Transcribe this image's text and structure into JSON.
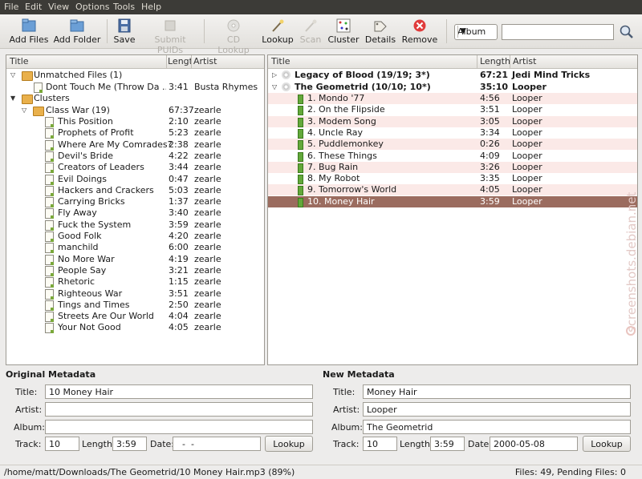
{
  "menu": [
    "File",
    "Edit",
    "View",
    "Options",
    "Tools",
    "Help"
  ],
  "toolbar": {
    "add_files": "Add Files",
    "add_folder": "Add Folder",
    "save": "Save",
    "submit_puids": "Submit PUIDs",
    "cd_lookup": "CD Lookup",
    "lookup": "Lookup",
    "scan": "Scan",
    "cluster": "Cluster",
    "details": "Details",
    "remove": "Remove",
    "search_type": "Album",
    "search_value": ""
  },
  "left_pane": {
    "col_title": "Title",
    "col_length": "Length",
    "col_artist": "Artist",
    "unmatched": {
      "label": "Unmatched Files (1)"
    },
    "unmatched_file": {
      "title": "Dont Touch Me (Throw Da ...",
      "length": "3:41",
      "artist": "Busta Rhymes"
    },
    "clusters": {
      "label": "Clusters"
    },
    "cluster": {
      "title": "Class War (19)",
      "length": "67:37",
      "artist": "zearle"
    },
    "files": [
      {
        "title": "This Position",
        "length": "2:10",
        "artist": "zearle"
      },
      {
        "title": "Prophets of Profit",
        "length": "5:23",
        "artist": "zearle"
      },
      {
        "title": "Where Are My Comrades?",
        "length": "2:38",
        "artist": "zearle"
      },
      {
        "title": "Devil's Bride",
        "length": "4:22",
        "artist": "zearle"
      },
      {
        "title": "Creators of Leaders",
        "length": "3:44",
        "artist": "zearle"
      },
      {
        "title": "Evil Doings",
        "length": "0:47",
        "artist": "zearle"
      },
      {
        "title": "Hackers and Crackers",
        "length": "5:03",
        "artist": "zearle"
      },
      {
        "title": "Carrying Bricks",
        "length": "1:37",
        "artist": "zearle"
      },
      {
        "title": "Fly Away",
        "length": "3:40",
        "artist": "zearle"
      },
      {
        "title": "Fuck the System",
        "length": "3:59",
        "artist": "zearle"
      },
      {
        "title": "Good Folk",
        "length": "4:20",
        "artist": "zearle"
      },
      {
        "title": "manchild",
        "length": "6:00",
        "artist": "zearle"
      },
      {
        "title": "No More War",
        "length": "4:19",
        "artist": "zearle"
      },
      {
        "title": "People Say",
        "length": "3:21",
        "artist": "zearle"
      },
      {
        "title": "Rhetoric",
        "length": "1:15",
        "artist": "zearle"
      },
      {
        "title": "Righteous War",
        "length": "3:51",
        "artist": "zearle"
      },
      {
        "title": "Tings and Times",
        "length": "2:50",
        "artist": "zearle"
      },
      {
        "title": "Streets Are Our World",
        "length": "4:04",
        "artist": "zearle"
      },
      {
        "title": "Your Not Good",
        "length": "4:05",
        "artist": "zearle"
      }
    ]
  },
  "right_pane": {
    "col_title": "Title",
    "col_length": "Length",
    "col_artist": "Artist",
    "albums": [
      {
        "title": "Legacy of Blood (19/19; 3*)",
        "length": "67:21",
        "artist": "Jedi Mind Tricks"
      },
      {
        "title": "The Geometrid (10/10; 10*)",
        "length": "35:10",
        "artist": "Looper"
      }
    ],
    "tracks": [
      {
        "title": "1. Mondo '77",
        "length": "4:56",
        "artist": "Looper"
      },
      {
        "title": "2. On the Flipside",
        "length": "3:51",
        "artist": "Looper"
      },
      {
        "title": "3. Modem Song",
        "length": "3:05",
        "artist": "Looper"
      },
      {
        "title": "4. Uncle Ray",
        "length": "3:34",
        "artist": "Looper"
      },
      {
        "title": "5. Puddlemonkey",
        "length": "0:26",
        "artist": "Looper"
      },
      {
        "title": "6. These Things",
        "length": "4:09",
        "artist": "Looper"
      },
      {
        "title": "7. Bug Rain",
        "length": "3:26",
        "artist": "Looper"
      },
      {
        "title": "8. My Robot",
        "length": "3:35",
        "artist": "Looper"
      },
      {
        "title": "9. Tomorrow's World",
        "length": "4:05",
        "artist": "Looper"
      },
      {
        "title": "10. Money Hair",
        "length": "3:59",
        "artist": "Looper"
      }
    ]
  },
  "original": {
    "heading": "Original Metadata",
    "title_label": "Title:",
    "title": "10 Money Hair",
    "artist_label": "Artist:",
    "artist": "",
    "album_label": "Album:",
    "album": "",
    "track_label": "Track:",
    "track": "10",
    "length_label": "Length:",
    "length": "3:59",
    "date_label": "Date:",
    "date": "  -  -",
    "lookup": "Lookup"
  },
  "new": {
    "heading": "New Metadata",
    "title_label": "Title:",
    "title": "Money Hair",
    "artist_label": "Artist:",
    "artist": "Looper",
    "album_label": "Album:",
    "album": "The Geometrid",
    "track_label": "Track:",
    "track": "10",
    "length_label": "Length:",
    "length": "3:59",
    "date_label": "Date:",
    "date": "2000-05-08",
    "lookup": "Lookup"
  },
  "status": {
    "path": "/home/matt/Downloads/The Geometrid/10 Money Hair.mp3 (89%)",
    "counts": "Files: 49, Pending Files: 0"
  },
  "watermark": "screenshots.debian.net",
  "colors": {
    "selection": "#9b6c5f",
    "menubar": "#3c3b37",
    "row_highlight": "#fbe9e7"
  }
}
